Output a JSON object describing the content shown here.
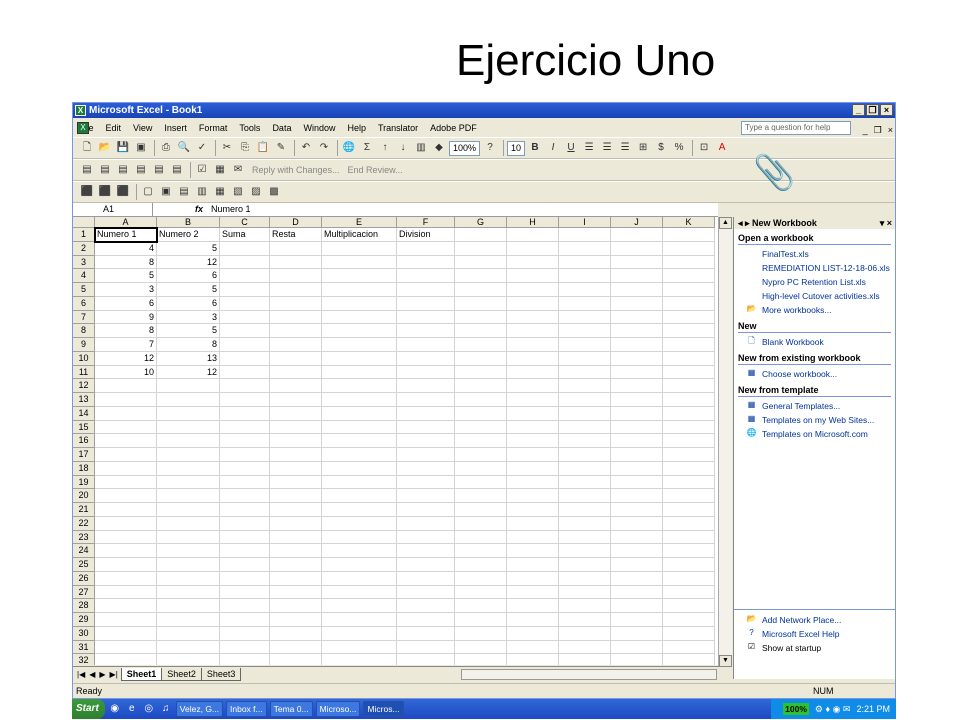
{
  "slide_title": "Ejercicio Uno",
  "window": {
    "title": "Microsoft Excel - Book1"
  },
  "menu": [
    "File",
    "Edit",
    "View",
    "Insert",
    "Format",
    "Tools",
    "Data",
    "Window",
    "Help",
    "Translator",
    "Adobe PDF"
  ],
  "ask_placeholder": "Type a question for help",
  "toolbar": {
    "zoom": "100%",
    "font_size": "10",
    "reply_changes": "Reply with Changes...",
    "end_review": "End Review..."
  },
  "formula": {
    "name_box": "A1",
    "fx": "fx",
    "content": "Numero 1"
  },
  "columns": [
    "A",
    "B",
    "C",
    "D",
    "E",
    "F",
    "G",
    "H",
    "I",
    "J",
    "K"
  ],
  "rows": [
    "1",
    "2",
    "3",
    "4",
    "5",
    "6",
    "7",
    "8",
    "9",
    "10",
    "11",
    "12",
    "13",
    "14",
    "15",
    "16",
    "17",
    "18",
    "19",
    "20",
    "21",
    "22",
    "23",
    "24",
    "25",
    "26",
    "27",
    "28",
    "29",
    "30",
    "31",
    "32"
  ],
  "headers": [
    "Numero 1",
    "Numero 2",
    "Suma",
    "Resta",
    "Multiplicacion",
    "Division"
  ],
  "data": [
    [
      "4",
      "5"
    ],
    [
      "8",
      "12"
    ],
    [
      "5",
      "6"
    ],
    [
      "3",
      "5"
    ],
    [
      "6",
      "6"
    ],
    [
      "9",
      "3"
    ],
    [
      "8",
      "5"
    ],
    [
      "7",
      "8"
    ],
    [
      "12",
      "13"
    ],
    [
      "10",
      "12"
    ]
  ],
  "sheets": [
    "Sheet1",
    "Sheet2",
    "Sheet3"
  ],
  "status": {
    "ready": "Ready",
    "num": "NUM"
  },
  "task_pane": {
    "title": "New Workbook",
    "open_header": "Open a workbook",
    "files": [
      "FinalTest.xls",
      "REMEDIATION LIST-12-18-06.xls",
      "Nypro PC Retention List.xls",
      "High-level Cutover activities.xls"
    ],
    "more": "More workbooks...",
    "new_header": "New",
    "blank": "Blank Workbook",
    "existing_header": "New from existing workbook",
    "choose": "Choose workbook...",
    "template_header": "New from template",
    "templates": [
      "General Templates...",
      "Templates on my Web Sites...",
      "Templates on Microsoft.com"
    ],
    "bottom_links": [
      "Add Network Place...",
      "Microsoft Excel Help"
    ],
    "show_startup": "Show at startup"
  },
  "taskbar": {
    "start": "Start",
    "tasks": [
      "Velez, G...",
      "Inbox f...",
      "Tema 0...",
      "Microso...",
      "Micros..."
    ],
    "battery": "100%",
    "clock": "2:21 PM"
  }
}
